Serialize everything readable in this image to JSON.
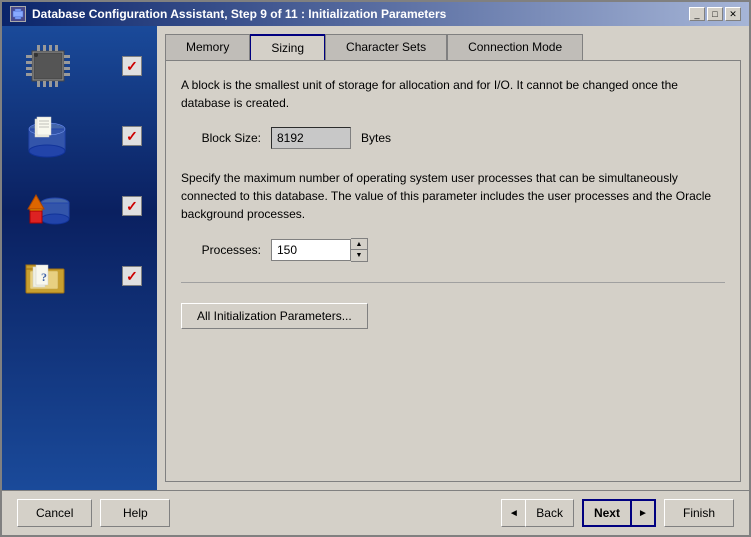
{
  "window": {
    "title": "Database Configuration Assistant, Step 9 of 11 : Initialization Parameters",
    "icon": "db-icon"
  },
  "title_buttons": {
    "minimize": "_",
    "maximize": "□",
    "close": "✕"
  },
  "tabs": [
    {
      "id": "memory",
      "label": "Memory",
      "active": false
    },
    {
      "id": "sizing",
      "label": "Sizing",
      "active": true
    },
    {
      "id": "character-sets",
      "label": "Character Sets",
      "active": false
    },
    {
      "id": "connection-mode",
      "label": "Connection Mode",
      "active": false
    }
  ],
  "sizing": {
    "block_description": "A block is the smallest unit of storage for allocation and for I/O. It cannot be changed once the database is created.",
    "block_size_label": "Block Size:",
    "block_size_value": "8192",
    "block_size_units": "Bytes",
    "processes_description": "Specify the maximum number of operating system user processes that can be simultaneously connected to this database. The value of this parameter includes the user processes and the Oracle background processes.",
    "processes_label": "Processes:",
    "processes_value": "150"
  },
  "all_params_button": "All Initialization Parameters...",
  "buttons": {
    "cancel": "Cancel",
    "help": "Help",
    "back": "Back",
    "next": "Next",
    "finish": "Finish"
  },
  "left_panel": {
    "items": [
      {
        "icon": "chip-icon",
        "checked": true
      },
      {
        "icon": "folder-docs-icon",
        "checked": true
      },
      {
        "icon": "db-shapes-icon",
        "checked": true
      },
      {
        "icon": "folder-question-icon",
        "checked": true
      }
    ]
  }
}
